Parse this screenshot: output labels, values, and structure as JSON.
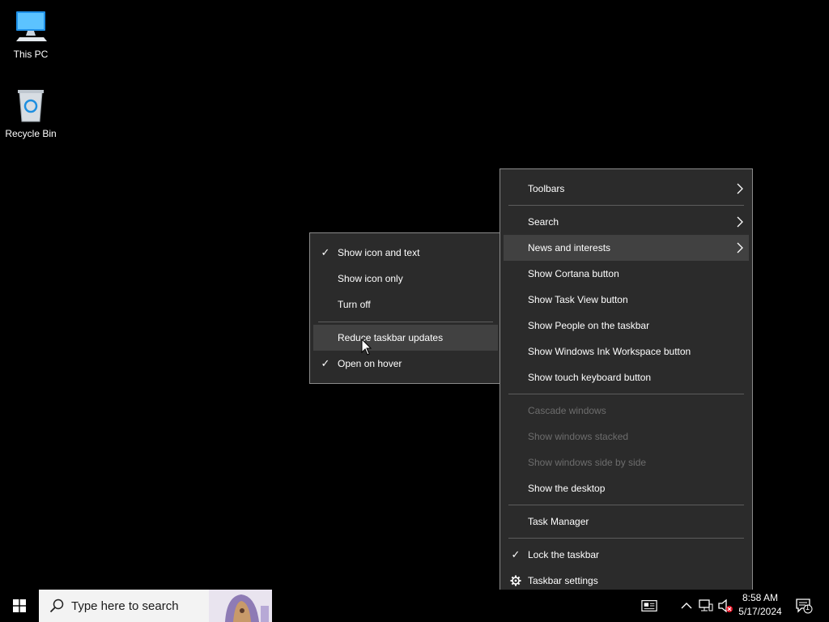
{
  "desktop": {
    "icons": [
      {
        "label": "This PC",
        "icon": "computer-icon"
      },
      {
        "label": "Recycle Bin",
        "icon": "recycle-bin-icon"
      }
    ]
  },
  "context_menu": {
    "items": [
      {
        "label": "Toolbars",
        "submenu": true
      },
      {
        "label": "Search",
        "submenu": true
      },
      {
        "label": "News and interests",
        "submenu": true,
        "highlighted": true
      },
      {
        "label": "Show Cortana button"
      },
      {
        "label": "Show Task View button"
      },
      {
        "label": "Show People on the taskbar"
      },
      {
        "label": "Show Windows Ink Workspace button"
      },
      {
        "label": "Show touch keyboard button"
      },
      {
        "label": "Cascade windows",
        "disabled": true
      },
      {
        "label": "Show windows stacked",
        "disabled": true
      },
      {
        "label": "Show windows side by side",
        "disabled": true
      },
      {
        "label": "Show the desktop"
      },
      {
        "label": "Task Manager"
      },
      {
        "label": "Lock the taskbar",
        "checked": true
      },
      {
        "label": "Taskbar settings",
        "icon": "gear-icon"
      }
    ]
  },
  "submenu": {
    "items": [
      {
        "label": "Show icon and text",
        "checked": true
      },
      {
        "label": "Show icon only"
      },
      {
        "label": "Turn off"
      },
      {
        "label": "Reduce taskbar updates",
        "highlighted": true
      },
      {
        "label": "Open on hover",
        "checked": true
      }
    ]
  },
  "taskbar": {
    "search_placeholder": "Type here to search",
    "time": "8:58 AM",
    "date": "5/17/2024",
    "notification_count": "1"
  },
  "colors": {
    "menu_bg": "#2b2b2b",
    "menu_hover": "#414141",
    "disabled_text": "#6d6d6d",
    "accent": "#0078d7"
  }
}
